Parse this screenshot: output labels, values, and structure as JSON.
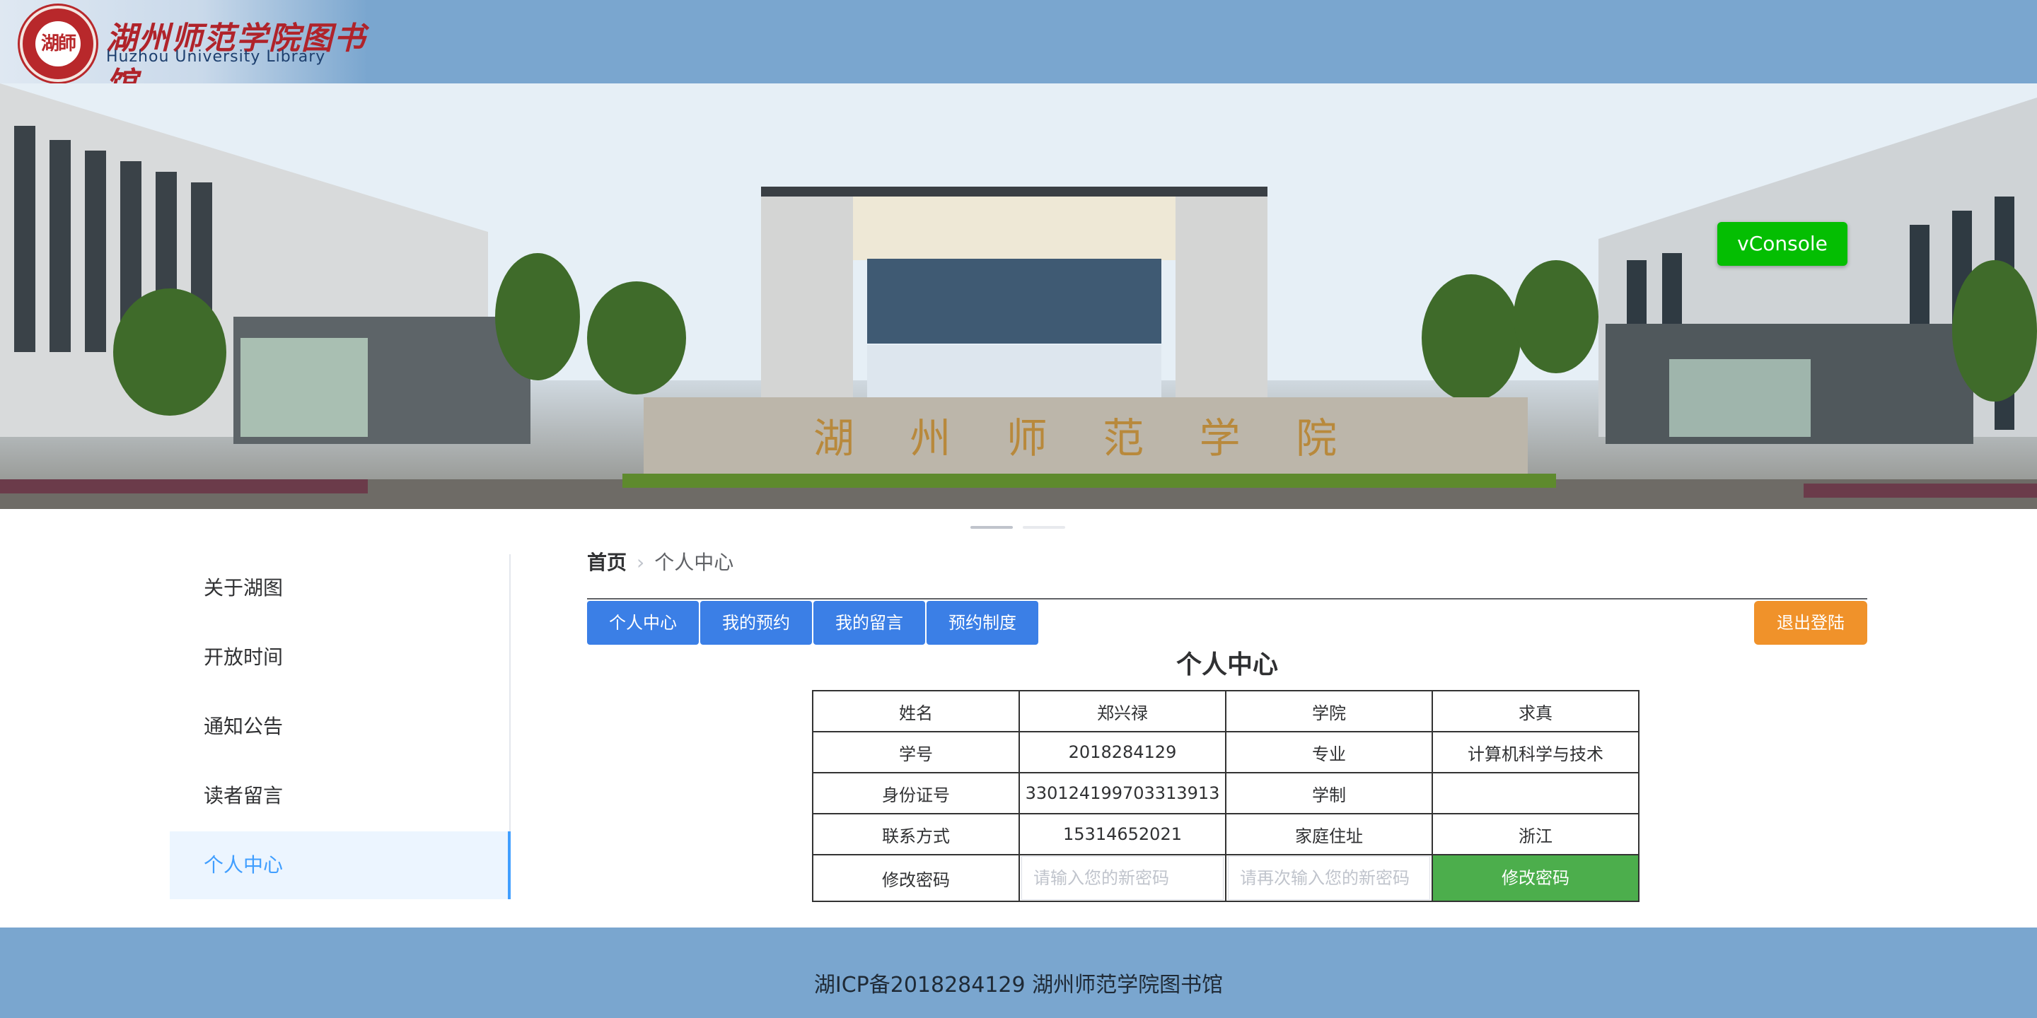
{
  "header": {
    "logo_seal_text": "湖師",
    "logo_cn": "湖州师范学院图书馆",
    "logo_en": "Huzhou University  Library"
  },
  "banner": {
    "gate_sign": "湖 州 师 范 学 院",
    "carousel_count": 2,
    "active_slide": 1
  },
  "vconsole": {
    "label": "vConsole",
    "color": "#04be02"
  },
  "sidebar": {
    "items": [
      {
        "label": "关于湖图",
        "active": false
      },
      {
        "label": "开放时间",
        "active": false
      },
      {
        "label": "通知公告",
        "active": false
      },
      {
        "label": "读者留言",
        "active": false
      },
      {
        "label": "个人中心",
        "active": true
      }
    ]
  },
  "breadcrumb": {
    "home": "首页",
    "separator": "›",
    "current": "个人中心"
  },
  "tabs": [
    "个人中心",
    "我的预约",
    "我的留言",
    "预约制度"
  ],
  "logout_label": "退出登陆",
  "page_title": "个人中心",
  "profile": {
    "rows": [
      [
        "姓名",
        "郑兴禄",
        "学院",
        "求真"
      ],
      [
        "学号",
        "2018284129",
        "专业",
        "计算机科学与技术"
      ],
      [
        "身份证号",
        "330124199703313913",
        "学制",
        ""
      ],
      [
        "联系方式",
        "15314652021",
        "家庭住址",
        "浙江"
      ]
    ],
    "password": {
      "label": "修改密码",
      "new_placeholder": "请输入您的新密码",
      "confirm_placeholder": "请再次输入您的新密码",
      "button_label": "修改密码"
    }
  },
  "footer": {
    "text": "湖ICP备2018284129 湖州师范学院图书馆"
  },
  "colors": {
    "header_bg": "#7aa6cf",
    "primary_blue": "#3b7fe6",
    "active_blue": "#409eff",
    "logout_orange": "#f0922a",
    "submit_green": "#4cae4c"
  }
}
